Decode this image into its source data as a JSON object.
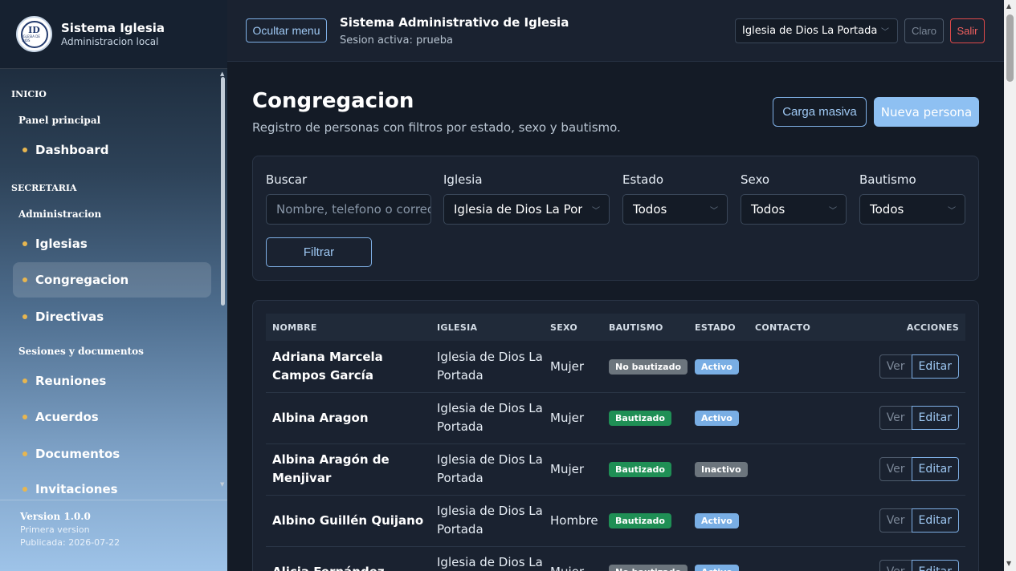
{
  "brand": {
    "title": "Sistema Iglesia",
    "subtitle": "Administracion local",
    "logo_text": "ID",
    "logo_small": "IGLESIA DE DIOS"
  },
  "sidebar": {
    "sections": [
      {
        "label": "INICIO"
      },
      {
        "label": "SECRETARIA"
      }
    ],
    "groups": [
      {
        "label": "Panel principal"
      },
      {
        "label": "Administracion"
      },
      {
        "label": "Sesiones y documentos"
      }
    ],
    "items": [
      {
        "label": "Dashboard"
      },
      {
        "label": "Iglesias"
      },
      {
        "label": "Congregacion"
      },
      {
        "label": "Directivas"
      },
      {
        "label": "Reuniones"
      },
      {
        "label": "Acuerdos"
      },
      {
        "label": "Documentos"
      },
      {
        "label": "Invitaciones"
      }
    ],
    "version": {
      "label": "Version 1.0.0",
      "note": "Primera version",
      "published": "Publicada: 2026-07-22"
    }
  },
  "topbar": {
    "toggle_label": "Ocultar menu",
    "title": "Sistema Administrativo de Iglesia",
    "session": "Sesion activa: prueba",
    "church_select": "Iglesia de Dios La Portada",
    "theme_label": "Claro",
    "logout_label": "Salir"
  },
  "page": {
    "title": "Congregacion",
    "subtitle": "Registro de personas con filtros por estado, sexo y bautismo.",
    "bulk_label": "Carga masiva",
    "new_label": "Nueva persona"
  },
  "filters": {
    "search_label": "Buscar",
    "search_placeholder": "Nombre, telefono o correo",
    "church_label": "Iglesia",
    "church_value": "Iglesia de Dios La Portada",
    "status_label": "Estado",
    "status_value": "Todos",
    "sex_label": "Sexo",
    "sex_value": "Todos",
    "baptism_label": "Bautismo",
    "baptism_value": "Todos",
    "filter_button": "Filtrar"
  },
  "table": {
    "headers": [
      "NOMBRE",
      "IGLESIA",
      "SEXO",
      "BAUTISMO",
      "ESTADO",
      "CONTACTO",
      "ACCIONES"
    ],
    "view_label": "Ver",
    "edit_label": "Editar",
    "rows": [
      {
        "name": "Adriana Marcela Campos García",
        "church": "Iglesia de Dios La Portada",
        "sex": "Mujer",
        "baptism": "No bautizado",
        "status": "Activo",
        "contact": ""
      },
      {
        "name": "Albina Aragon",
        "church": "Iglesia de Dios La Portada",
        "sex": "Mujer",
        "baptism": "Bautizado",
        "status": "Activo",
        "contact": ""
      },
      {
        "name": "Albina Aragón de Menjivar",
        "church": "Iglesia de Dios La Portada",
        "sex": "Mujer",
        "baptism": "Bautizado",
        "status": "Inactivo",
        "contact": ""
      },
      {
        "name": "Albino Guillén Quijano",
        "church": "Iglesia de Dios La Portada",
        "sex": "Hombre",
        "baptism": "Bautizado",
        "status": "Activo",
        "contact": ""
      },
      {
        "name": "Alicia Fernández",
        "church": "Iglesia de Dios La Portada",
        "sex": "Mujer",
        "baptism": "No bautizado",
        "status": "Activo",
        "contact": ""
      }
    ]
  },
  "colors": {
    "accent": "#8ec0f2",
    "baptized": "#1f8f55",
    "not_baptized": "#6c757d",
    "active": "#79aee4",
    "inactive": "#6c757d",
    "logout": "#e04a4a",
    "nav_dot": "#e7b650"
  }
}
